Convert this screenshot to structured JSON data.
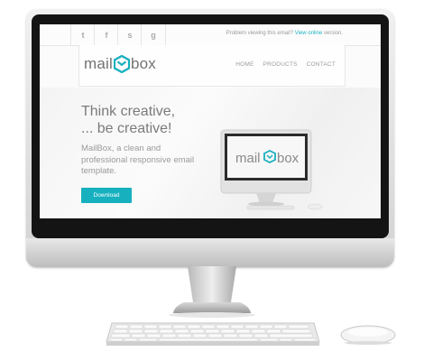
{
  "social_icons": [
    {
      "icon": "twitter-icon",
      "glyph": "t"
    },
    {
      "icon": "facebook-icon",
      "glyph": "f"
    },
    {
      "icon": "skype-icon",
      "glyph": "s"
    },
    {
      "icon": "google-plus-icon",
      "glyph": "g"
    }
  ],
  "topbar": {
    "view_text": "Problem viewing this email? ",
    "view_link": "View online",
    "view_suffix": " version."
  },
  "logo": {
    "left": "mail",
    "right": "box",
    "accent": "#17b0bf"
  },
  "nav": [
    "HOME",
    "PRODUCTS",
    "CONTACT"
  ],
  "hero": {
    "headline_1": "Think creative,",
    "headline_2": "... be creative!",
    "description": "MailBox, a clean and professional responsive email template.",
    "button_label": "Download"
  },
  "colors": {
    "accent": "#17b0bf",
    "text": "#7b7b7b"
  }
}
